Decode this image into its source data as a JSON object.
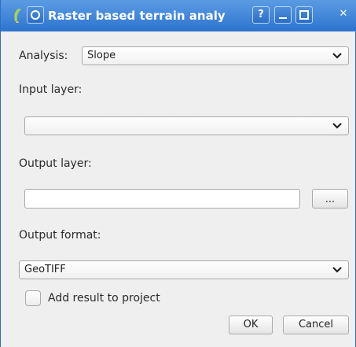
{
  "window": {
    "title": "Raster based terrain analy",
    "help_button": "?",
    "close_button": "✕"
  },
  "analysis": {
    "label": "Analysis:",
    "selected": "Slope"
  },
  "input_layer": {
    "label": "Input layer:",
    "selected": ""
  },
  "output_layer": {
    "label": "Output layer:",
    "value": "",
    "browse_label": "..."
  },
  "output_format": {
    "label": "Output format:",
    "selected": "GeoTIFF"
  },
  "add_result": {
    "label": "Add result to project",
    "checked": false
  },
  "buttons": {
    "ok": "OK",
    "cancel": "Cancel"
  },
  "colors": {
    "titlebar": "#2d74cf",
    "window_bg": "#efefef"
  }
}
